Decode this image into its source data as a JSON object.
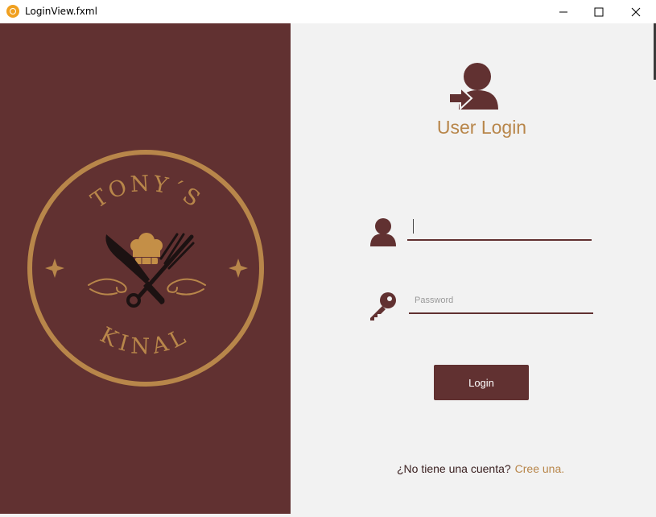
{
  "window": {
    "title": "LoginView.fxml",
    "minimize_glyph": "—",
    "maximize_glyph": "☐",
    "close_glyph": "✕"
  },
  "logo": {
    "top_text": "TONY´S",
    "bottom_text": "KINAL"
  },
  "login": {
    "title": "User Login",
    "username_value": "",
    "password_placeholder": "Password",
    "button_label": "Login",
    "signup_prompt": "¿No tiene una cuenta?",
    "signup_link": "Cree una."
  },
  "icons": {
    "login_header": "user-login-icon",
    "username": "user-icon",
    "password": "key-icon"
  },
  "colors": {
    "brand_maroon": "#613131",
    "accent_gold": "#b8864a",
    "panel_background": "#f2f2f2"
  }
}
